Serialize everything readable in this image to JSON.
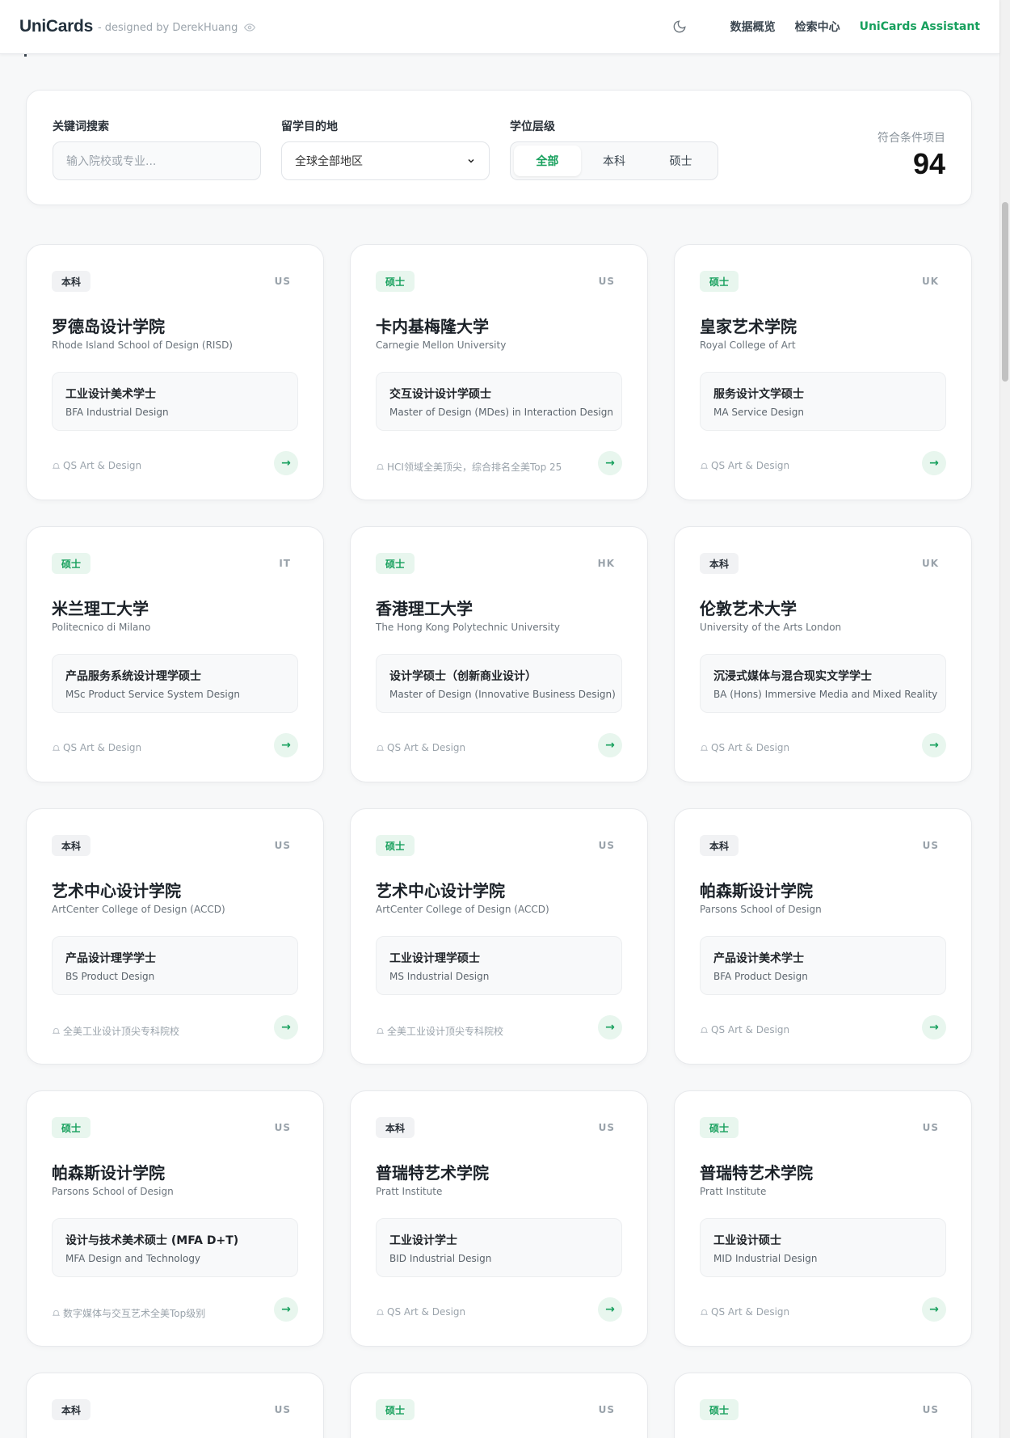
{
  "header": {
    "brand": "UniCards",
    "subtitle": "- designed by DerekHuang",
    "nav": [
      "数据概览",
      "检索中心",
      "UniCards Assistant"
    ]
  },
  "filter": {
    "keyword_label": "关键词搜索",
    "keyword_placeholder": "输入院校或专业...",
    "destination_label": "留学目的地",
    "destination_value": "全球全部地区",
    "degree_label": "学位层级",
    "degree_options": [
      "全部",
      "本科",
      "硕士"
    ],
    "count_label": "符合条件项目",
    "count_value": "94"
  },
  "cards": [
    {
      "degree": "本科",
      "country": "US",
      "name_cn": "罗德岛设计学院",
      "name_en": "Rhode Island School of Design (RISD)",
      "program_cn": "工业设计美术学士",
      "program_en": "BFA Industrial Design",
      "tag": "QS Art & Design"
    },
    {
      "degree": "硕士",
      "country": "US",
      "name_cn": "卡内基梅隆大学",
      "name_en": "Carnegie Mellon University",
      "program_cn": "交互设计设计学硕士",
      "program_en": "Master of Design (MDes) in Interaction Design",
      "tag": "HCI领域全美顶尖，综合排名全美Top 25"
    },
    {
      "degree": "硕士",
      "country": "UK",
      "name_cn": "皇家艺术学院",
      "name_en": "Royal College of Art",
      "program_cn": "服务设计文学硕士",
      "program_en": "MA Service Design",
      "tag": "QS Art & Design"
    },
    {
      "degree": "硕士",
      "country": "IT",
      "name_cn": "米兰理工大学",
      "name_en": "Politecnico di Milano",
      "program_cn": "产品服务系统设计理学硕士",
      "program_en": "MSc Product Service System Design",
      "tag": "QS Art & Design"
    },
    {
      "degree": "硕士",
      "country": "HK",
      "name_cn": "香港理工大学",
      "name_en": "The Hong Kong Polytechnic University",
      "program_cn": "设计学硕士（创新商业设计）",
      "program_en": "Master of Design (Innovative Business Design)",
      "tag": "QS Art & Design"
    },
    {
      "degree": "本科",
      "country": "UK",
      "name_cn": "伦敦艺术大学",
      "name_en": "University of the Arts London",
      "program_cn": "沉浸式媒体与混合现实文学学士",
      "program_en": "BA (Hons) Immersive Media and Mixed Reality",
      "tag": "QS Art & Design"
    },
    {
      "degree": "本科",
      "country": "US",
      "name_cn": "艺术中心设计学院",
      "name_en": "ArtCenter College of Design (ACCD)",
      "program_cn": "产品设计理学学士",
      "program_en": "BS Product Design",
      "tag": "全美工业设计顶尖专科院校"
    },
    {
      "degree": "硕士",
      "country": "US",
      "name_cn": "艺术中心设计学院",
      "name_en": "ArtCenter College of Design (ACCD)",
      "program_cn": "工业设计理学硕士",
      "program_en": "MS Industrial Design",
      "tag": "全美工业设计顶尖专科院校"
    },
    {
      "degree": "本科",
      "country": "US",
      "name_cn": "帕森斯设计学院",
      "name_en": "Parsons School of Design",
      "program_cn": "产品设计美术学士",
      "program_en": "BFA Product Design",
      "tag": "QS Art & Design"
    },
    {
      "degree": "硕士",
      "country": "US",
      "name_cn": "帕森斯设计学院",
      "name_en": "Parsons School of Design",
      "program_cn": "设计与技术美术硕士 (MFA D+T)",
      "program_en": "MFA Design and Technology",
      "tag": "数字媒体与交互艺术全美Top级别"
    },
    {
      "degree": "本科",
      "country": "US",
      "name_cn": "普瑞特艺术学院",
      "name_en": "Pratt Institute",
      "program_cn": "工业设计学士",
      "program_en": "BID Industrial Design",
      "tag": "QS Art & Design"
    },
    {
      "degree": "硕士",
      "country": "US",
      "name_cn": "普瑞特艺术学院",
      "name_en": "Pratt Institute",
      "program_cn": "工业设计硕士",
      "program_en": "MID Industrial Design",
      "tag": "QS Art & Design"
    },
    {
      "degree": "本科",
      "country": "US"
    },
    {
      "degree": "硕士",
      "country": "US"
    },
    {
      "degree": "硕士",
      "country": "US"
    }
  ]
}
